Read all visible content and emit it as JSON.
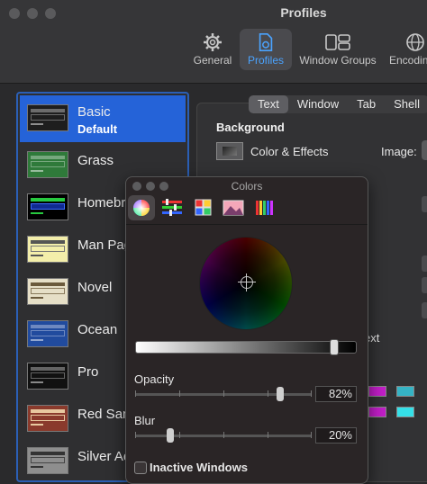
{
  "window": {
    "title": "Profiles"
  },
  "toolbar": {
    "items": [
      {
        "label": "General",
        "icon": "gear-icon"
      },
      {
        "label": "Profiles",
        "icon": "document-gear-icon",
        "active": true
      },
      {
        "label": "Window Groups",
        "icon": "window-groups-icon"
      },
      {
        "label": "Encodin",
        "icon": "globe-icon"
      }
    ]
  },
  "profiles": {
    "items": [
      {
        "name": "Basic",
        "subtitle": "Default",
        "selected": true,
        "thumb_color": "#1e1e1e"
      },
      {
        "name": "Grass",
        "thumb_color": "#2f7a3a"
      },
      {
        "name": "Homebre",
        "thumb_color": "#000000"
      },
      {
        "name": "Man Pag",
        "thumb_color": "#f3eeaa"
      },
      {
        "name": "Novel",
        "thumb_color": "#e6dfc7"
      },
      {
        "name": "Ocean",
        "thumb_color": "#214b9e"
      },
      {
        "name": "Pro",
        "thumb_color": "#111111"
      },
      {
        "name": "Red Sanc",
        "thumb_color": "#8a3a2c"
      },
      {
        "name": "Silver Ae",
        "thumb_color": "#8e8e8e"
      }
    ]
  },
  "tabs": [
    "Text",
    "Window",
    "Tab",
    "Shell"
  ],
  "tabs_selected": "Text",
  "background": {
    "heading": "Background",
    "color_effects": "Color & Effects",
    "image_label": "Image:"
  },
  "partial_text": "ext",
  "colors_panel": {
    "title": "Colors",
    "tools": [
      "color-wheel-icon",
      "color-sliders-icon",
      "color-palettes-icon",
      "image-palettes-icon",
      "pencils-icon"
    ],
    "brightness": 0.9,
    "opacity_label": "Opacity",
    "opacity_value": "82%",
    "opacity": 0.82,
    "blur_label": "Blur",
    "blur_value": "20%",
    "blur": 0.2,
    "inactive_label": "Inactive Windows"
  },
  "colors": {
    "accent": "#2563d8",
    "swatch_magenta": "#c21ec8",
    "swatch_cyan": "#35b3c4"
  }
}
